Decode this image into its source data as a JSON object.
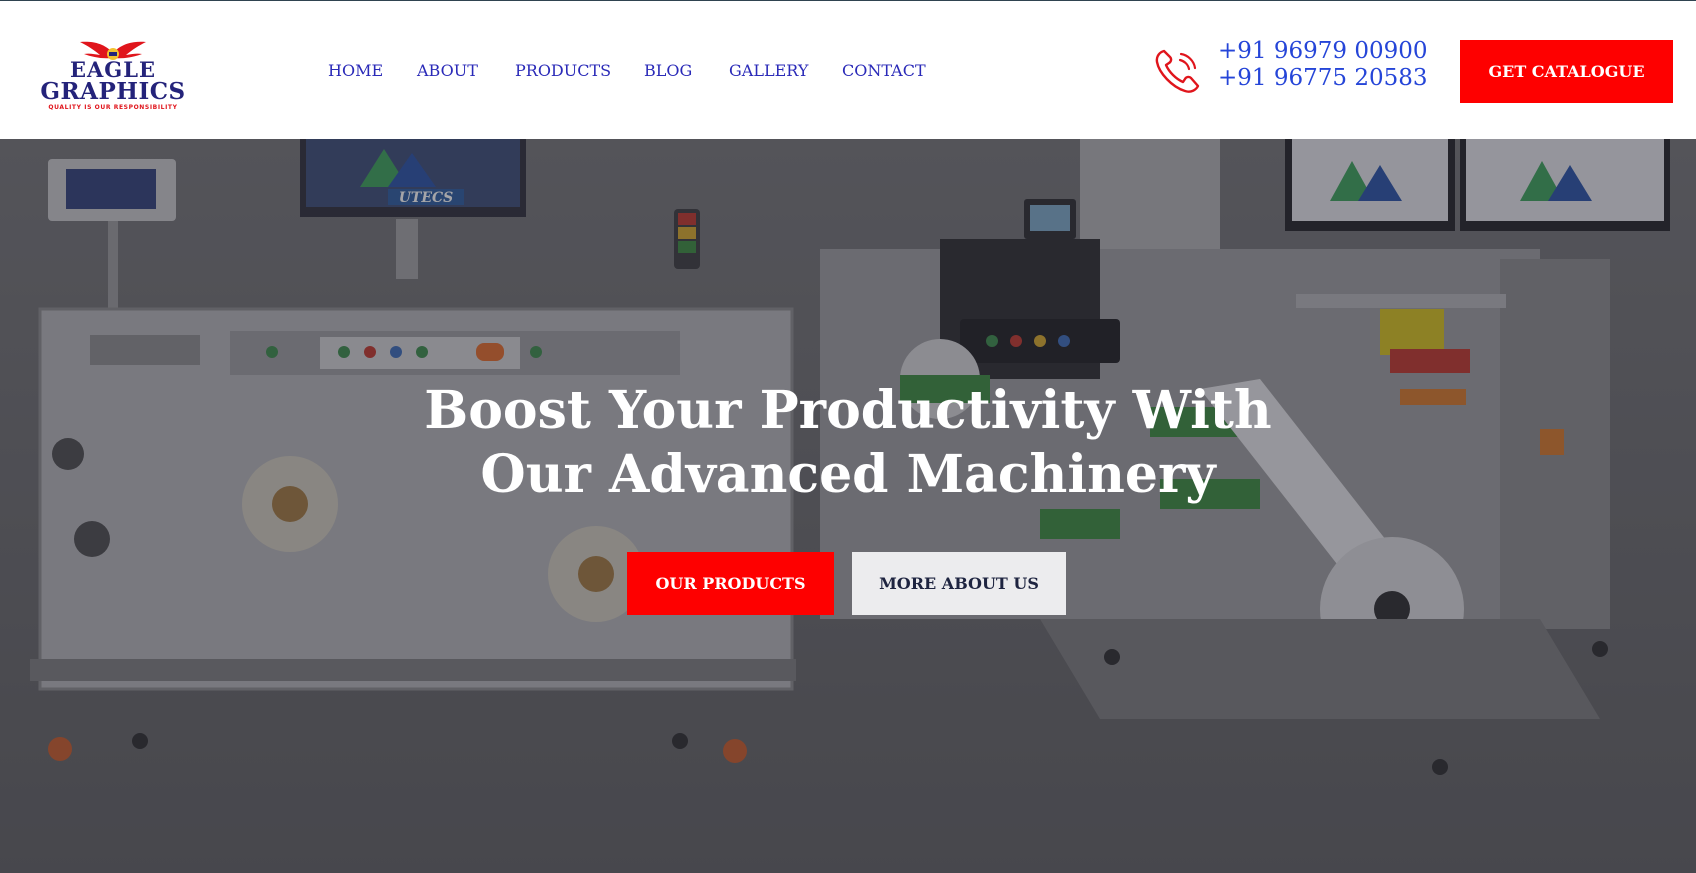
{
  "brand": {
    "logo_line1": "EAGLE",
    "logo_line2": "GRAPHICS",
    "logo_tagline": "QUALITY IS OUR RESPONSIBILITY",
    "primary_color": "#fe0000",
    "navy_color": "#24237a",
    "link_color": "#2a2ab8"
  },
  "nav": {
    "items": [
      {
        "label": "HOME"
      },
      {
        "label": "ABOUT"
      },
      {
        "label": "PRODUCTS"
      },
      {
        "label": "BLOG"
      },
      {
        "label": "GALLERY"
      },
      {
        "label": "CONTACT"
      }
    ]
  },
  "contact": {
    "icon": "phone-icon",
    "phone1": "+91 96979 00900",
    "phone2": "+91 96775 20583"
  },
  "header_cta": {
    "label": "GET CATALOGUE"
  },
  "hero": {
    "headline_line1": "Boost Your Productivity With",
    "headline_line2": "Our Advanced Machinery",
    "primary_button": "OUR PRODUCTS",
    "secondary_button": "MORE ABOUT US",
    "monitor_text": "UTECS"
  }
}
